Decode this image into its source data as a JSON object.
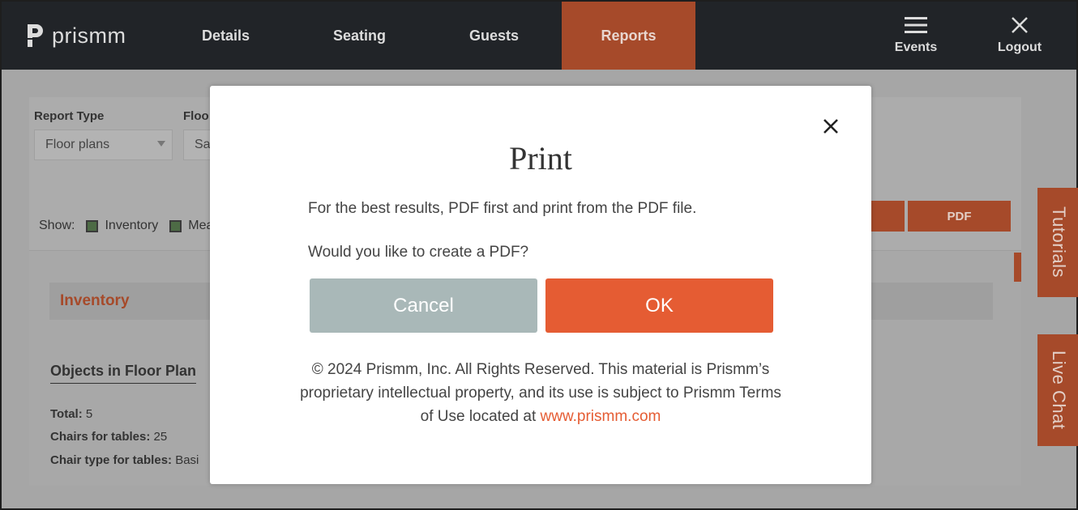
{
  "brand": {
    "name": "prismm"
  },
  "nav": {
    "items": [
      "Details",
      "Seating",
      "Guests",
      "Reports"
    ],
    "active": "Reports",
    "events_label": "Events",
    "logout_label": "Logout"
  },
  "report": {
    "report_type_label": "Report Type",
    "report_type_value": "Floor plans",
    "floor_label": "Floo",
    "floor_value": "Sar",
    "show_label": "Show:",
    "show_options": [
      "Inventory",
      "Mea"
    ],
    "pdf_label": "PDF",
    "section_title": "Inventory",
    "objects_title": "Objects in Floor Plan",
    "stats": [
      {
        "label": "Total:",
        "value": "5"
      },
      {
        "label": "Chairs for tables:",
        "value": "25"
      },
      {
        "label": "Chair type for tables:",
        "value": "Basi"
      }
    ]
  },
  "side_tabs": {
    "tutorials": "Tutorials",
    "live_chat": "Live Chat"
  },
  "modal": {
    "title": "Print",
    "line1": "For the best results, PDF first and print from the PDF file.",
    "line2": "Would you like to create a PDF?",
    "cancel_label": "Cancel",
    "ok_label": "OK",
    "legal_text": "© 2024 Prismm, Inc. All Rights Reserved. This material is Prismm’s proprietary intellectual property, and its use is subject to Prismm Terms of Use located at ",
    "legal_link": "www.prismm.com"
  },
  "colors": {
    "accent": "#e55c33",
    "accent_dim": "#a64a2a",
    "nav_bg": "#212428",
    "cancel_bg": "#a9b8b8"
  }
}
